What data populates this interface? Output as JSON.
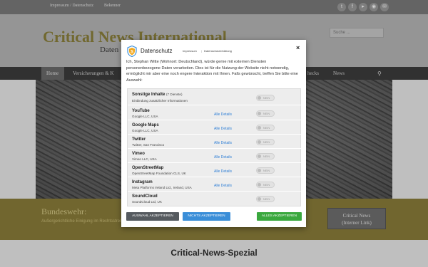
{
  "site": {
    "top_links": [
      "Impressum / Datenschutz",
      "Bekenner"
    ],
    "social_icons": [
      "twitter-icon",
      "facebook-icon",
      "youtube-icon",
      "rss-icon",
      "mail-icon"
    ],
    "title": "Critical News International",
    "subtitle": "Daten",
    "search_placeholder": "Suche ...",
    "nav": {
      "home": "Home",
      "item2": "Versicherungen & K",
      "item3": "hecks",
      "news": "News"
    },
    "banner_title": "Bundeswehr:",
    "banner_sub": "Außergerichtliche Einigung im Rechtsstreit",
    "news_box": "Critical News\n(Interner Link)",
    "section_heading": "Critical-News-Spezial"
  },
  "dialog": {
    "title": "Datenschutz",
    "links": [
      "Impressum",
      "Datenschutzerklärung"
    ],
    "separator": "|",
    "close": "×",
    "intro": "Ich, Stephan Witte (Wohnort: Deutschland), würde gerne mit externen Diensten personenbezogene Daten verarbeiten. Dies ist für die Nutzung der Website nicht notwendig, ermöglicht mir aber eine noch engere Interaktion mit Ihnen. Falls gewünscht, treffen Sie bitte eine Auswahl:",
    "group": {
      "name": "Sonstige Inhalte",
      "count": "(7 Dienste)",
      "description": "Einbindung zusätzlicher Informationen"
    },
    "toggle_label": "NEIN",
    "details_label": "Alle Details",
    "services": [
      {
        "name": "YouTube",
        "company": "Google LLC, USA"
      },
      {
        "name": "Google Maps",
        "company": "Google LLC, USA"
      },
      {
        "name": "Twitter",
        "company": "Twitter, San Francisco"
      },
      {
        "name": "Vimeo",
        "company": "Vimeo LLC, USA"
      },
      {
        "name": "OpenStreetMap",
        "company": "OpenStreetMap Foundation CLS, UK"
      },
      {
        "name": "Instagram",
        "company": "Meta Platforms Ireland Ltd., Ireland, USA"
      },
      {
        "name": "SoundCloud",
        "company": "SoundCloud Ltd, UK"
      }
    ],
    "buttons": {
      "accept_selection": "AUSWAHL AKZEPTIEREN",
      "reject": "NICHTS AKZEPTIEREN",
      "accept_all": "ALLES AKZEPTIEREN"
    }
  },
  "colors": {
    "gold": "#8a7d3a",
    "link_blue": "#2f7fd6",
    "accept_green": "#3aa83e",
    "reject_blue": "#3a8ed8"
  }
}
